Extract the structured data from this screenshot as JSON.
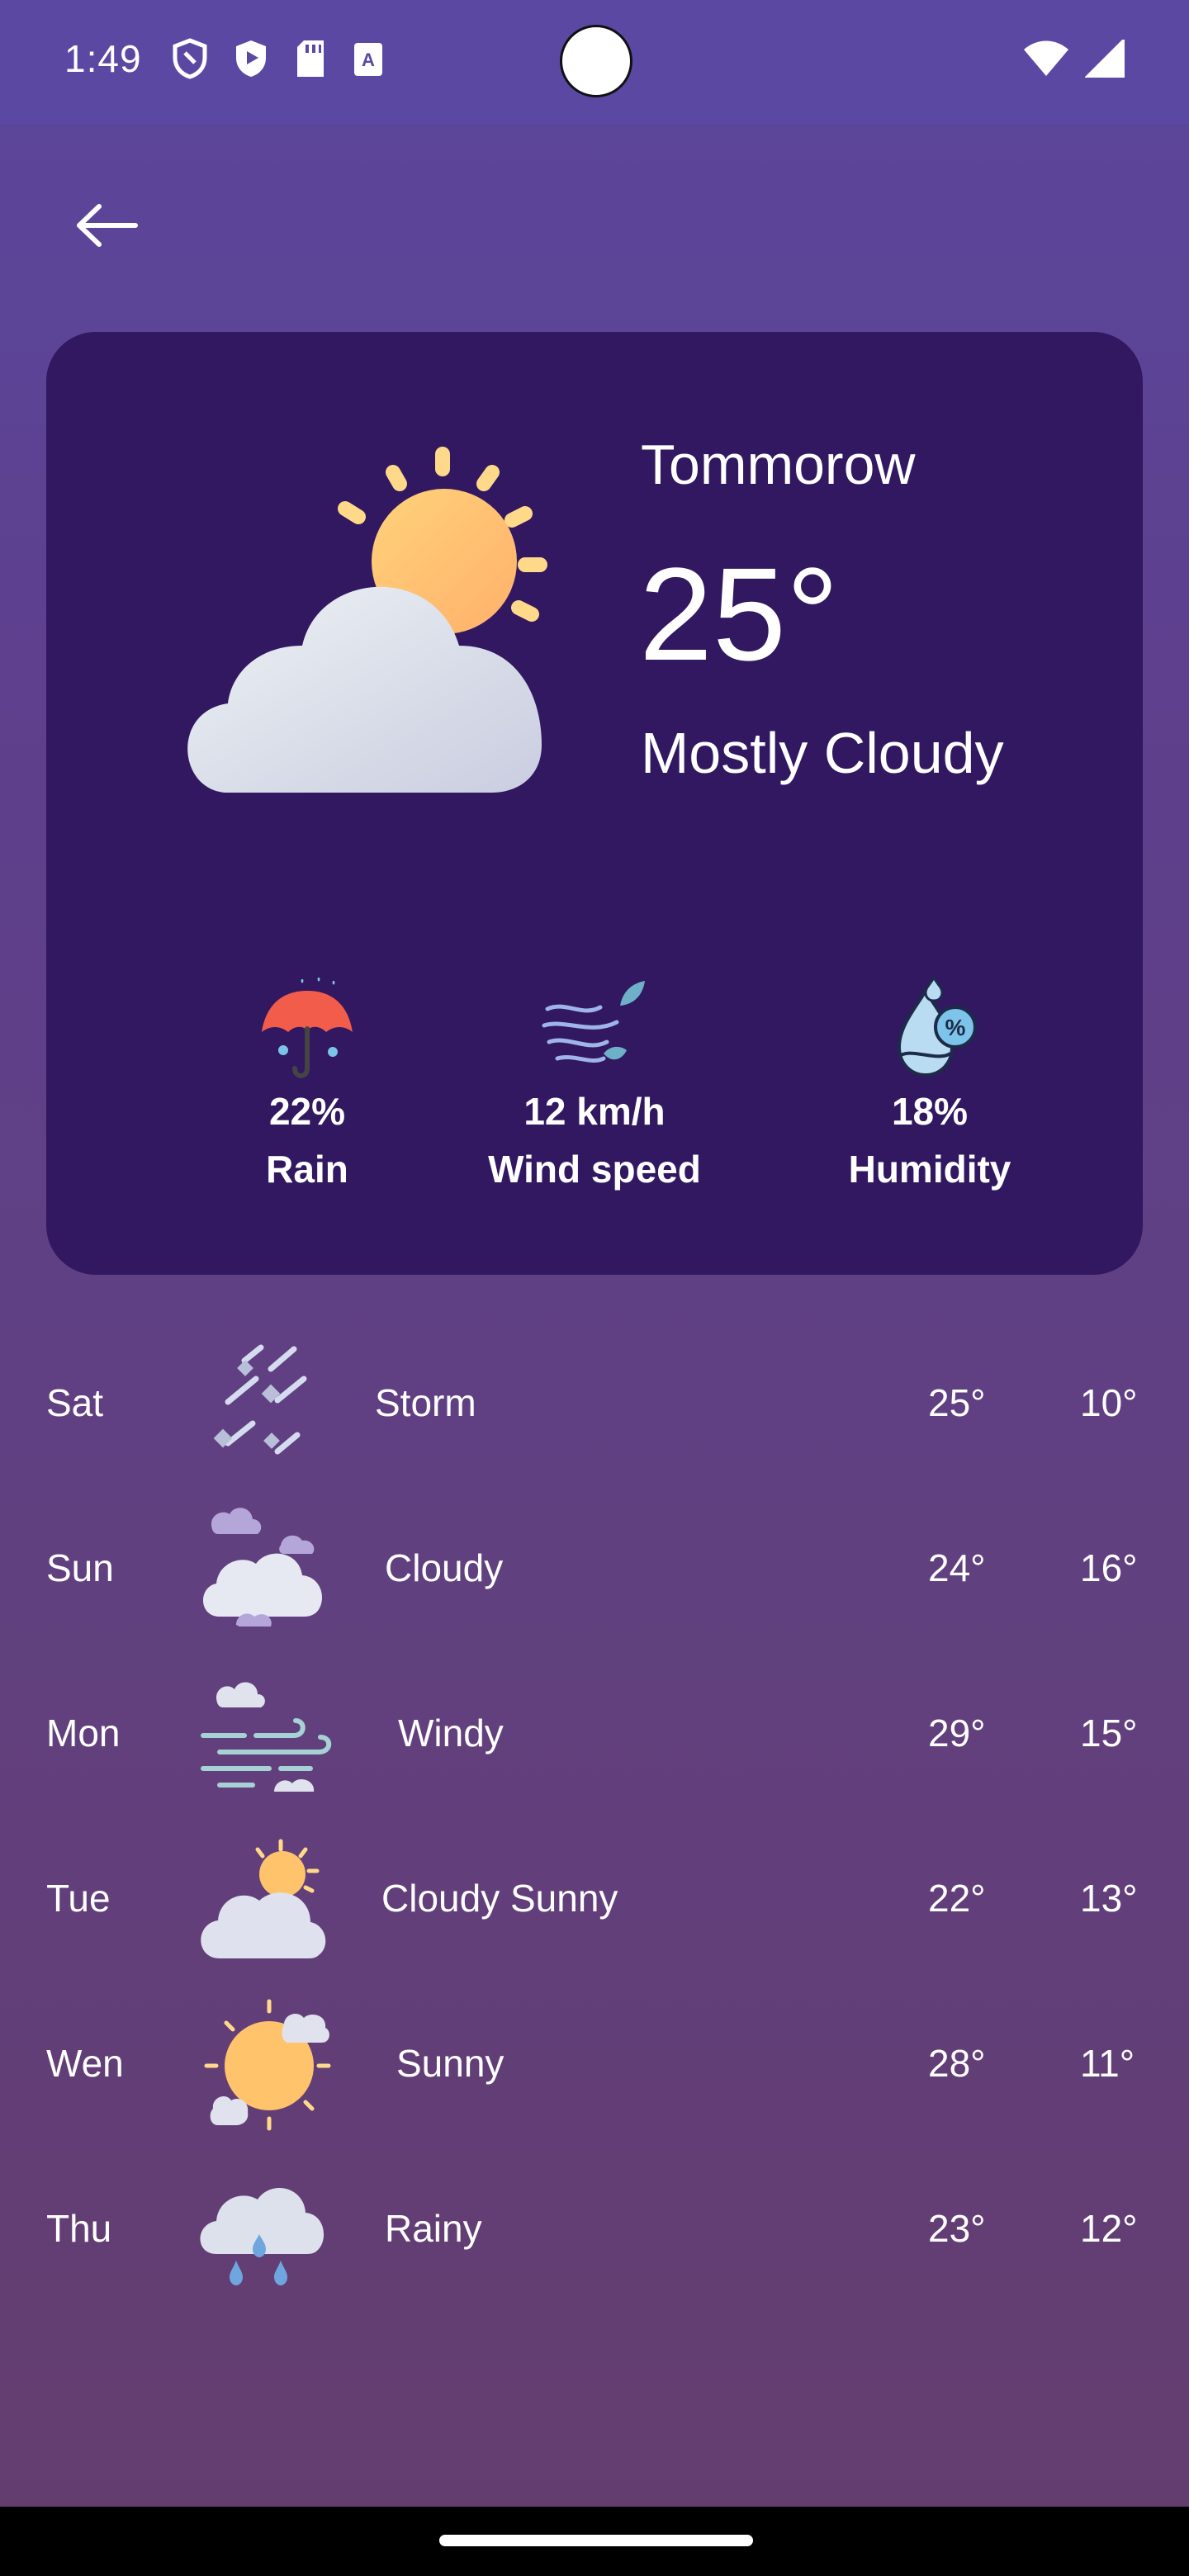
{
  "status": {
    "time": "1:49"
  },
  "hero": {
    "day": "Tommorow",
    "temperature": "25°",
    "condition": "Mostly Cloudy",
    "icon": "sun-behind-cloud-icon"
  },
  "stats": [
    {
      "value": "22%",
      "label": "Rain",
      "icon": "umbrella-icon"
    },
    {
      "value": "12 km/h",
      "label": "Wind speed",
      "icon": "wind-icon"
    },
    {
      "value": "18%",
      "label": "Humidity",
      "icon": "humidity-icon"
    }
  ],
  "forecast": [
    {
      "day": "Sat",
      "condition": "Storm",
      "high": "25°",
      "low": "10°",
      "icon": "storm-icon"
    },
    {
      "day": "Sun",
      "condition": "Cloudy",
      "high": "24°",
      "low": "16°",
      "icon": "cloudy-icon"
    },
    {
      "day": "Mon",
      "condition": "Windy",
      "high": "29°",
      "low": "15°",
      "icon": "windy-icon"
    },
    {
      "day": "Tue",
      "condition": "Cloudy Sunny",
      "high": "22°",
      "low": "13°",
      "icon": "cloudy-sunny-icon"
    },
    {
      "day": "Wen",
      "condition": "Sunny",
      "high": "28°",
      "low": "11°",
      "icon": "sunny-icon"
    },
    {
      "day": "Thu",
      "condition": "Rainy",
      "high": "23°",
      "low": "12°",
      "icon": "rainy-icon"
    }
  ],
  "colors": {
    "card": "#311861",
    "background": "#5e4390",
    "accent_sun": "#ffc36b"
  }
}
